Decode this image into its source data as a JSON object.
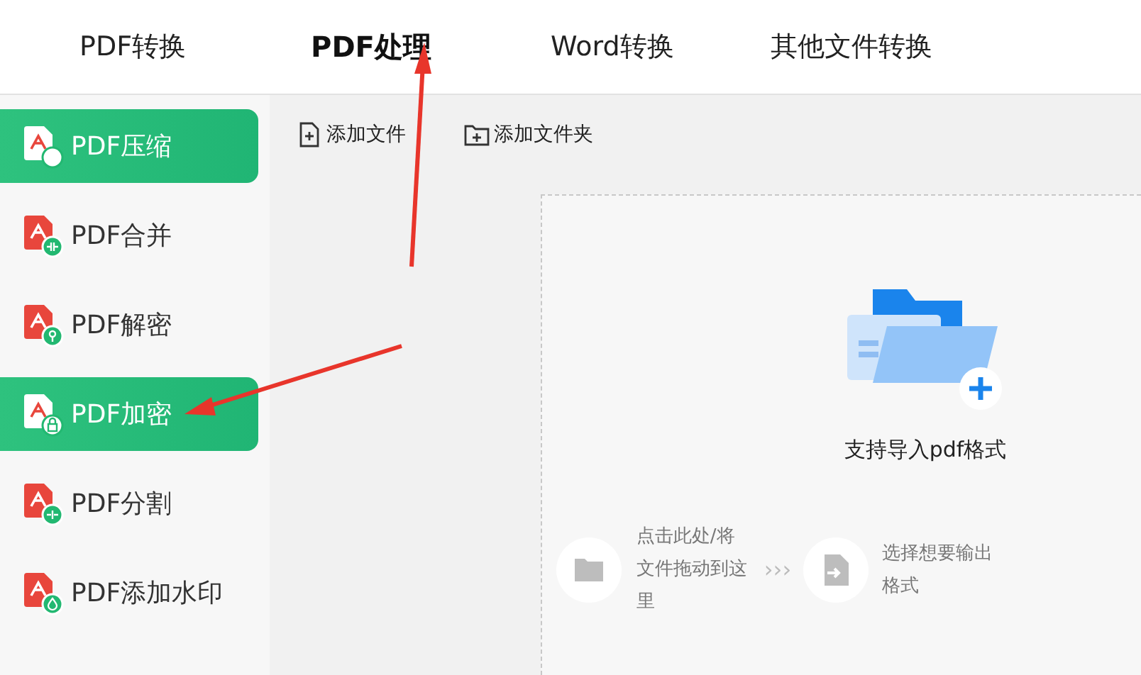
{
  "tabs": [
    {
      "label": "PDF转换",
      "selected": false
    },
    {
      "label": "PDF处理",
      "selected": true
    },
    {
      "label": "Word转换",
      "selected": false
    },
    {
      "label": "其他文件转换",
      "selected": false
    }
  ],
  "sidebar": {
    "items": [
      {
        "label": "PDF压缩",
        "kind": "compress",
        "selected": true
      },
      {
        "label": "PDF合并",
        "kind": "merge",
        "selected": false
      },
      {
        "label": "PDF解密",
        "kind": "decrypt",
        "selected": false
      },
      {
        "label": "PDF加密",
        "kind": "encrypt",
        "selected": true
      },
      {
        "label": "PDF分割",
        "kind": "split",
        "selected": false
      },
      {
        "label": "PDF添加水印",
        "kind": "watermark",
        "selected": false
      }
    ]
  },
  "toolbar": [
    {
      "label": "添加文件",
      "kind": "file"
    },
    {
      "label": "添加文件夹",
      "kind": "folder"
    }
  ],
  "drop_zone": {
    "hint": "支持导入pdf格式",
    "separator": "›››",
    "steps": [
      {
        "text": "点击此处/将文件拖动到这里",
        "kind": "open"
      },
      {
        "text": "选择想要输出格式",
        "kind": "output"
      }
    ]
  }
}
